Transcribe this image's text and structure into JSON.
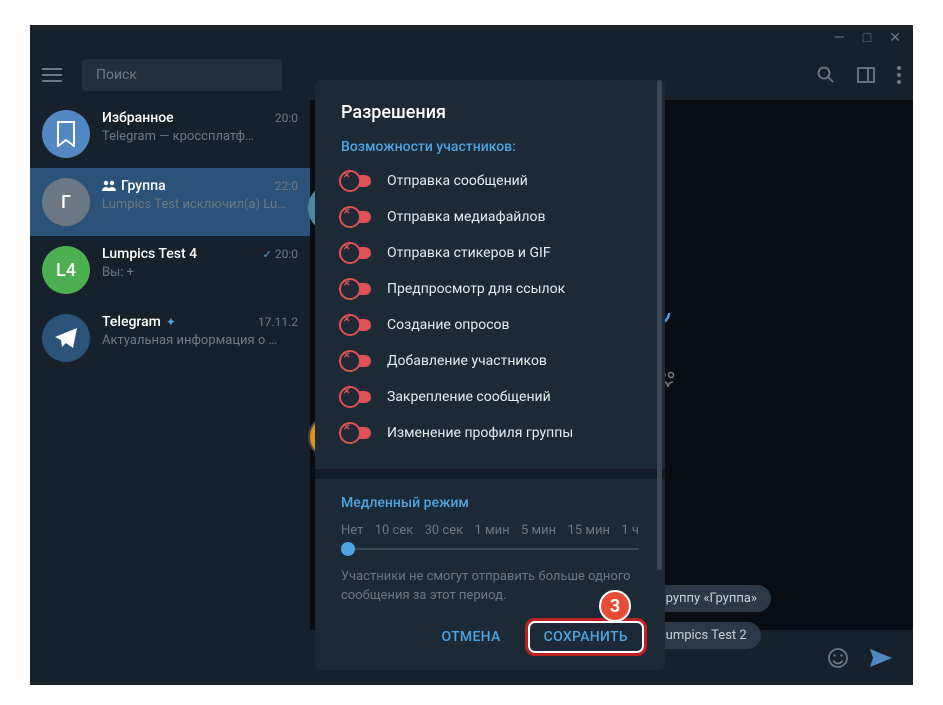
{
  "window": {
    "minimize": "—",
    "maximize": "□",
    "close": "✕"
  },
  "search": {
    "placeholder": "Поиск"
  },
  "chats": [
    {
      "name": "Избранное",
      "time": "20:0",
      "preview": "Telegram — кроссплатф…",
      "avatar": "saved",
      "letter": ""
    },
    {
      "name": "Группа",
      "time": "22:0",
      "preview": "Lumpics Test исключил(а) Lu…",
      "avatar": "grey",
      "letter": "Г",
      "group": true
    },
    {
      "name": "Lumpics Test 4",
      "time": "20:0",
      "preview": "Вы: +",
      "avatar": "green",
      "letter": "L4",
      "check": true
    },
    {
      "name": "Telegram",
      "time": "17.11.2",
      "preview": "Актуальная информация о …",
      "avatar": "tg",
      "letter": "",
      "verified": true
    }
  ],
  "panel": {
    "title": "Разрешения",
    "subtitle": "Возможности участников:",
    "permissions": [
      "Отправка сообщений",
      "Отправка медиафайлов",
      "Отправка стикеров и GIF",
      "Предпросмотр для ссылок",
      "Создание опросов",
      "Добавление участников",
      "Закрепление сообщений",
      "Изменение профиля группы"
    ],
    "slowmode": {
      "title": "Медленный режим",
      "labels": [
        "Нет",
        "10 сек",
        "30 сек",
        "1 мин",
        "5 мин",
        "15 мин",
        "1 ч"
      ],
      "desc": "Участники не смогут отправить больше одного сообщения за этот период."
    },
    "cancel": "ОТМЕНА",
    "save": "СОХРАНИТЬ"
  },
  "chips": [
    "руппу «Группа»",
    "umpics Test 2"
  ],
  "badge": "3"
}
